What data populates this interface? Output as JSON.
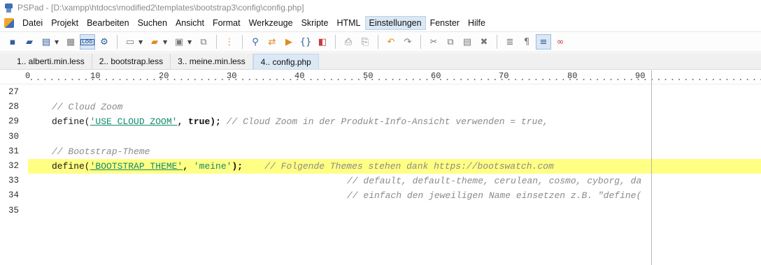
{
  "window": {
    "title": "PSPad - [D:\\xampp\\htdocs\\modified2\\templates\\bootstrap3\\config\\config.php]"
  },
  "menu": {
    "items": [
      "Datei",
      "Projekt",
      "Bearbeiten",
      "Suchen",
      "Ansicht",
      "Format",
      "Werkzeuge",
      "Skripte",
      "HTML",
      "Einstellungen",
      "Fenster",
      "Hilfe"
    ],
    "active": "Einstellungen"
  },
  "toolbar": {
    "log_label": "LOG"
  },
  "tabs": [
    {
      "label": "1.. alberti.min.less"
    },
    {
      "label": "2.. bootstrap.less"
    },
    {
      "label": "3.. meine.min.less"
    },
    {
      "label": "4.. config.php",
      "active": true
    }
  ],
  "ruler": {
    "labels": [
      "0",
      "10",
      "20",
      "30",
      "40",
      "50",
      "60",
      "70",
      "80",
      "90"
    ]
  },
  "editor": {
    "highlight_color": "#ffff84",
    "lines": [
      {
        "number": "27",
        "text": ""
      },
      {
        "number": "28",
        "comment": "// Cloud Zoom"
      },
      {
        "number": "29",
        "fn": "define(",
        "str": "'USE_CLOUD_ZOOM'",
        "sep": ", ",
        "kw": "true",
        "end": ");",
        "trail_comment": " // Cloud Zoom in der Produkt-Info-Ansicht verwenden = true,"
      },
      {
        "number": "30",
        "text": ""
      },
      {
        "number": "31",
        "comment": "// Bootstrap-Theme"
      },
      {
        "number": "32",
        "fn": "define(",
        "str": "'BOOTSTRAP_THEME'",
        "sep": ", ",
        "str2": "'meine'",
        "end": ");",
        "trail_comment": "    // Folgende Themes stehen dank https://bootswatch.com"
      },
      {
        "number": "33",
        "indent_comment": "// default, default-theme, cerulean, cosmo, cyborg, da"
      },
      {
        "number": "34",
        "indent_comment": "// einfach den jeweiligen Name einsetzen z.B. \"define("
      },
      {
        "number": "35",
        "text": ""
      }
    ]
  }
}
